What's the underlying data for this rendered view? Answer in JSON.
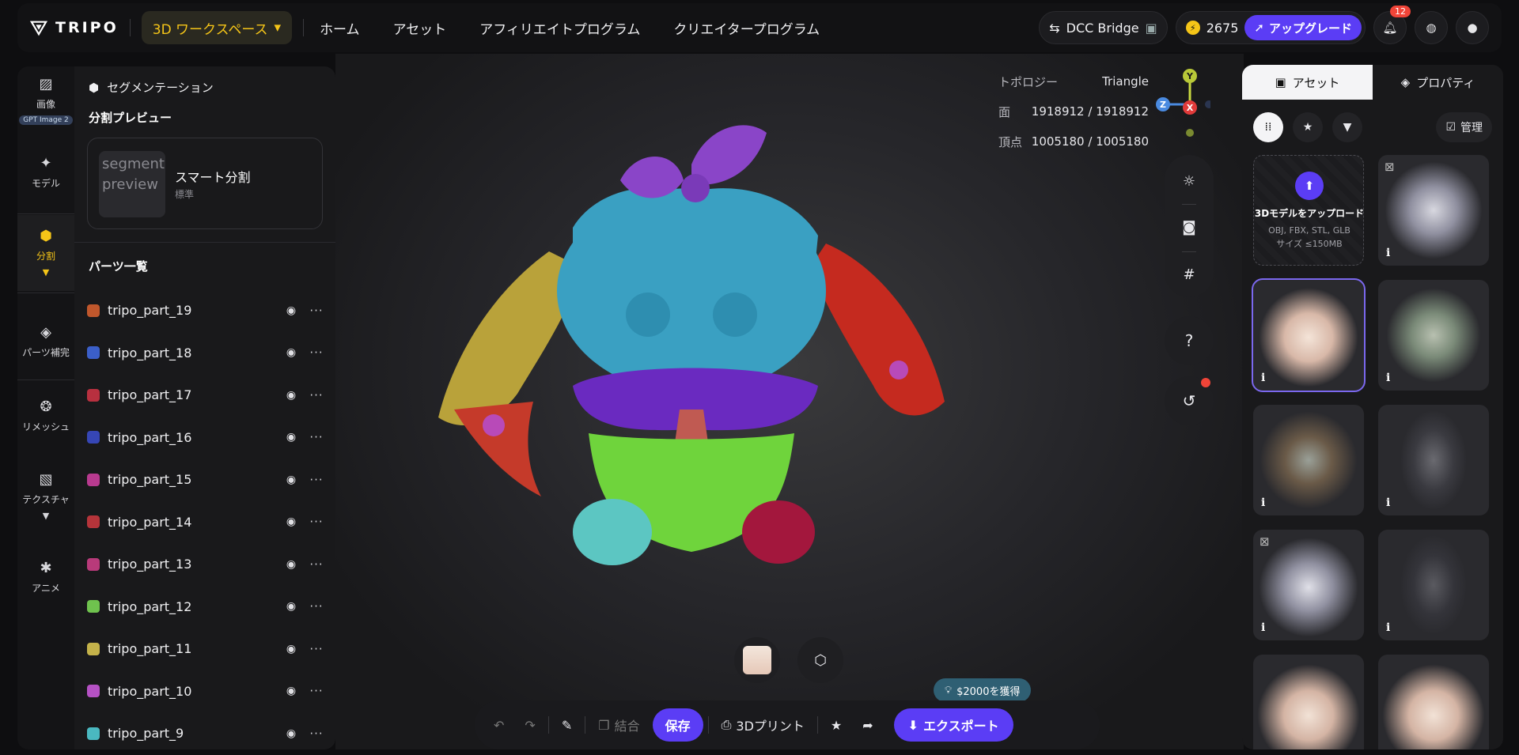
{
  "app": {
    "brand": "TRIPO"
  },
  "topbar": {
    "workspace_label": "3D ワークスペース",
    "nav": [
      "ホーム",
      "アセット",
      "アフィリエイトプログラム",
      "クリエイタープログラム"
    ],
    "dcc_label": "DCC Bridge",
    "credits": "2675",
    "upgrade_label": "アップグレード",
    "notifications": "12"
  },
  "rail": {
    "image": "画像",
    "image_badge": "GPT Image 2",
    "model": "モデル",
    "split": "分割",
    "parts_fill": "パーツ補完",
    "remesh": "リメッシュ",
    "texture": "テクスチャ",
    "anime": "アニメ"
  },
  "panel": {
    "header": "セグメンテーション",
    "preview_title": "分割プレビュー",
    "thumb_alt": "segment preview",
    "smart_title": "スマート分割",
    "smart_desc": "標準",
    "parts_title": "パーツ一覧",
    "parts": [
      {
        "name": "tripo_part_19",
        "color": "#c0572c"
      },
      {
        "name": "tripo_part_18",
        "color": "#3b5fc9"
      },
      {
        "name": "tripo_part_17",
        "color": "#b8303f"
      },
      {
        "name": "tripo_part_16",
        "color": "#3646b5"
      },
      {
        "name": "tripo_part_15",
        "color": "#b83a8f"
      },
      {
        "name": "tripo_part_14",
        "color": "#b5343a"
      },
      {
        "name": "tripo_part_13",
        "color": "#b83a7a"
      },
      {
        "name": "tripo_part_12",
        "color": "#6fc24e"
      },
      {
        "name": "tripo_part_11",
        "color": "#c4b24a"
      },
      {
        "name": "tripo_part_10",
        "color": "#b551c4"
      },
      {
        "name": "tripo_part_9",
        "color": "#4ab8c0"
      }
    ]
  },
  "viewport": {
    "topology_label": "トポロジー",
    "topology_value": "Triangle",
    "faces_label": "面",
    "faces_value": "1918912 / 1918912",
    "verts_label": "頂点",
    "verts_value": "1005180 / 1005180",
    "axis_y": "Y",
    "axis_z": "Z",
    "axis_x": "X"
  },
  "toolbar": {
    "merge": "結合",
    "save": "保存",
    "print": "3Dプリント",
    "export": "エクスポート",
    "promo": "$2000を獲得"
  },
  "rpanel": {
    "tab_assets": "アセット",
    "tab_props": "プロパティ",
    "manage": "管理",
    "upload_title": "3Dモデルをアップロード",
    "upload_formats": "OBJ, FBX, STL, GLB",
    "upload_size": "サイズ ≤150MB",
    "info": "i"
  }
}
